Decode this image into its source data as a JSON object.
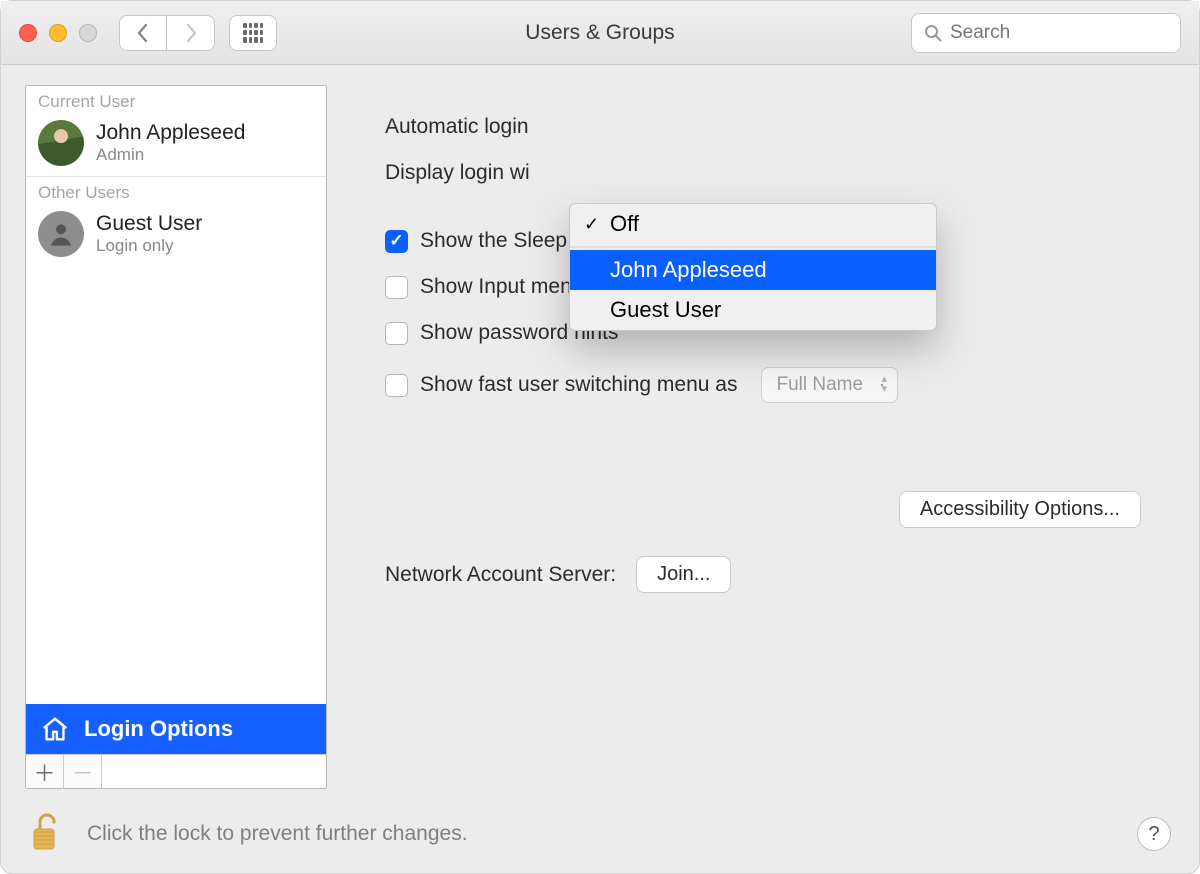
{
  "window": {
    "title": "Users & Groups",
    "search_placeholder": "Search"
  },
  "sidebar": {
    "current_user_label": "Current User",
    "other_users_label": "Other Users",
    "current_user": {
      "name": "John Appleseed",
      "role": "Admin"
    },
    "other_user": {
      "name": "Guest User",
      "role": "Login only"
    },
    "login_options_label": "Login Options"
  },
  "main": {
    "automatic_login_label": "Automatic login",
    "display_login_label": "Display login wi",
    "cb_sleep": "Show the Sleep, Restart, and Shut Down buttons",
    "cb_input_menu": "Show Input menu in login window",
    "cb_hints": "Show password hints",
    "cb_fastswitch": "Show fast user switching menu as",
    "fastswitch_value": "Full Name",
    "accessibility_btn": "Accessibility Options...",
    "network_label": "Network Account Server:",
    "join_btn": "Join..."
  },
  "dropdown": {
    "off": "Off",
    "opt1": "John Appleseed",
    "opt2": "Guest User"
  },
  "footer": {
    "lock_text": "Click the lock to prevent further changes.",
    "help": "?"
  }
}
